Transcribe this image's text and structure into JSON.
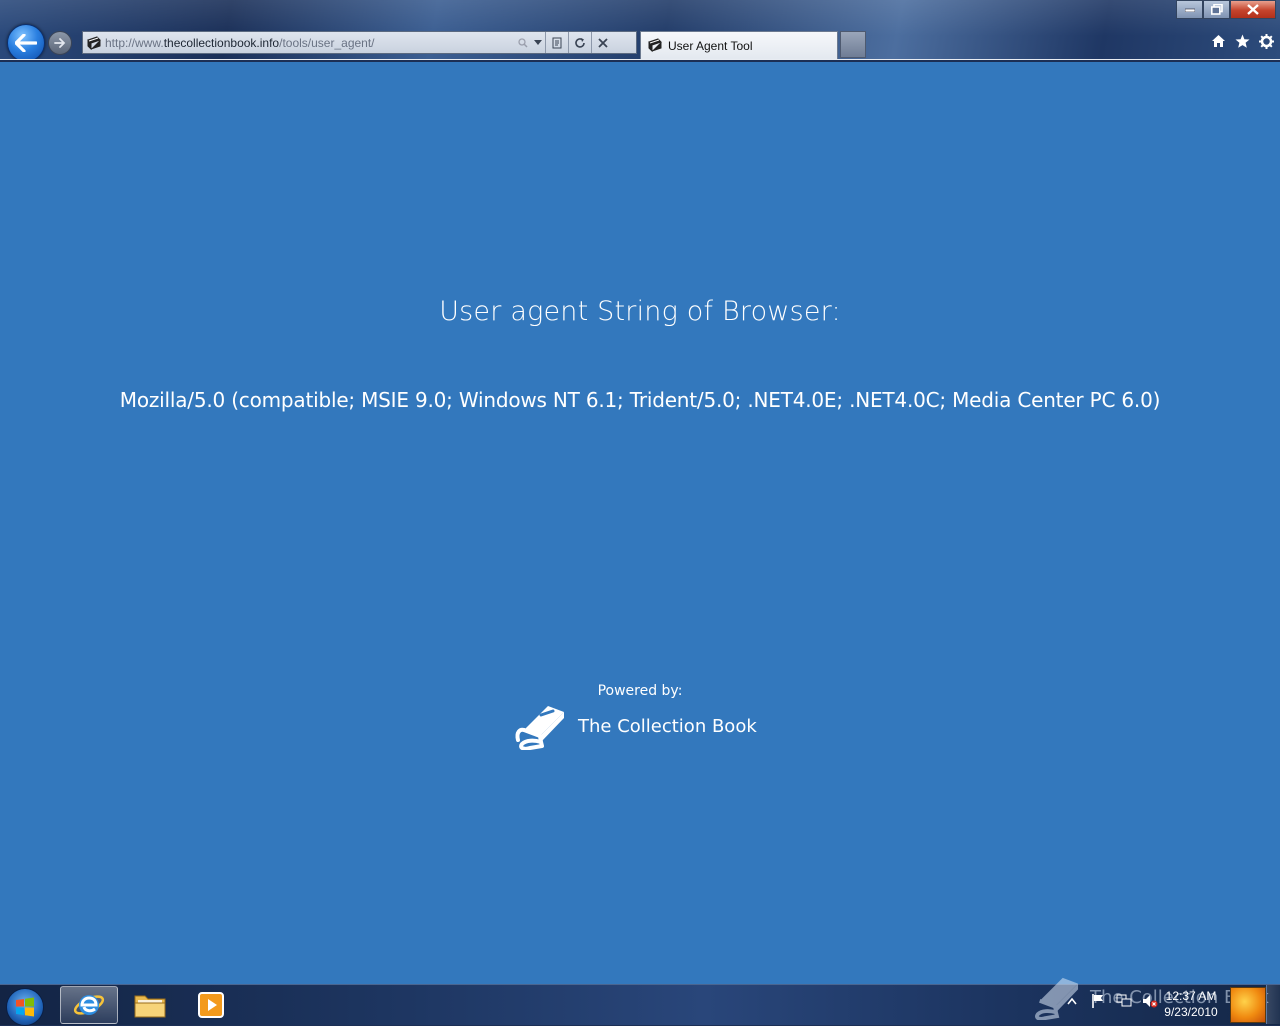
{
  "browser": {
    "address_bar": {
      "url_prefix": "http://www.",
      "url_domain": "thecollectionbook.info",
      "url_path": "/tools/user_agent/"
    },
    "active_tab": {
      "title": "User Agent Tool"
    },
    "window_controls": [
      "minimize",
      "restore",
      "close"
    ],
    "toolbar_icons": [
      "home-icon",
      "favorites-star-icon",
      "tools-gear-icon"
    ]
  },
  "page": {
    "heading": "User agent String of Browser:",
    "user_agent": "Mozilla/5.0 (compatible; MSIE 9.0; Windows NT 6.1; Trident/5.0; .NET4.0E; .NET4.0C; Media Center PC 6.0)",
    "powered_by": "Powered by:",
    "brand_name": "The Collection Book",
    "background_color": "#3378bd"
  },
  "taskbar": {
    "pinned": [
      "internet-explorer",
      "windows-explorer",
      "media-player"
    ],
    "watermark": "The Collection Book",
    "clock": {
      "time": "12:37 AM",
      "date": "9/23/2010"
    }
  }
}
